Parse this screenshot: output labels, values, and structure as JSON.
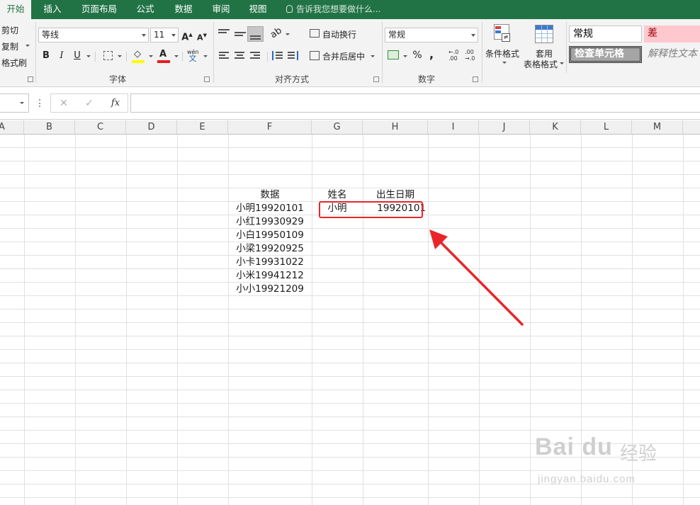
{
  "tabs": [
    {
      "label": "开始",
      "active": true
    },
    {
      "label": "插入"
    },
    {
      "label": "页面布局"
    },
    {
      "label": "公式"
    },
    {
      "label": "数据"
    },
    {
      "label": "审阅"
    },
    {
      "label": "视图"
    }
  ],
  "tell_me": "告诉我您想要做什么...",
  "ribbon": {
    "clipboard": {
      "cut": "剪切",
      "copy": "复制",
      "format_painter": "格式刷"
    },
    "font": {
      "name": "等线",
      "size": "11",
      "group_label": "字体",
      "bold": "B",
      "italic": "I",
      "underline": "U",
      "wen": "wén",
      "wen_char": "文"
    },
    "alignment": {
      "wrap_text": "自动换行",
      "merge_center": "合并后居中",
      "group_label": "对齐方式"
    },
    "number": {
      "format": "常规",
      "percent": "%",
      "comma": ",",
      "inc_decimal": "←.0 .00",
      "dec_decimal": ".00 →.0",
      "group_label": "数字"
    },
    "styles": {
      "conditional_formatting": "条件格式",
      "format_as_table_1": "套用",
      "format_as_table_2": "表格格式",
      "style_normal": "常规",
      "style_bad": "差",
      "style_check_cell": "检查单元格",
      "style_explanatory": "解释性文本"
    }
  },
  "formula_bar": {
    "name_box": "",
    "cancel": "✕",
    "enter": "✓",
    "fx": "fx",
    "formula": ""
  },
  "columns": [
    "A",
    "B",
    "C",
    "D",
    "E",
    "F",
    "G",
    "H",
    "I",
    "J",
    "K",
    "L",
    "M"
  ],
  "cells": {
    "F_header": "数据",
    "G_header": "姓名",
    "H_header": "出生日期",
    "F_values": [
      "小明19920101",
      "小红19930929",
      "小白19950109",
      "小梁19920925",
      "小卡19931022",
      "小米19941212",
      "小小19921209"
    ],
    "G_result": "小明",
    "H_result": "19920101"
  },
  "watermark": {
    "logo": "Bai du",
    "text": "经验",
    "url": "jingyan.baidu.com"
  },
  "colors": {
    "tab_green": "#217346",
    "highlight_red": "#e8262a",
    "style_bad_bg": "#ffc7ce",
    "style_check_bg": "#a5a5a5"
  }
}
